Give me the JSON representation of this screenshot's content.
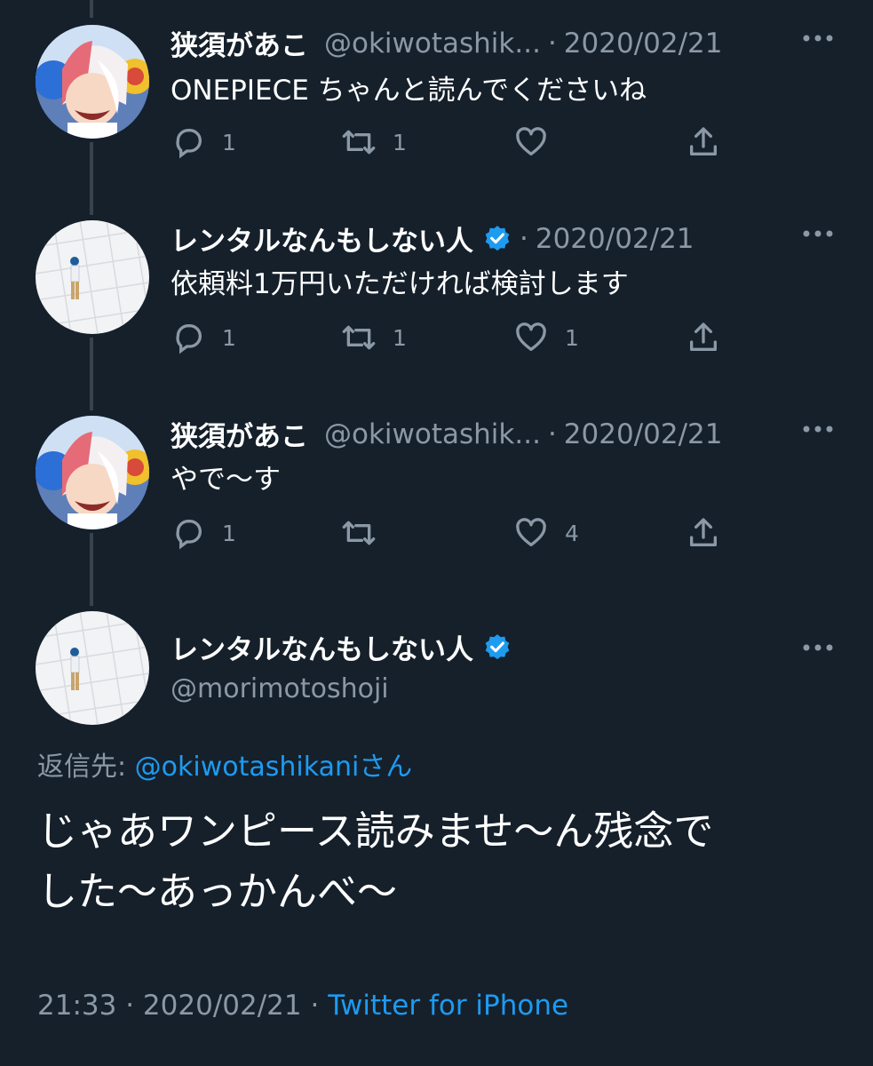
{
  "tweets": [
    {
      "name": "狭須があこ",
      "handle": "@okiwotashik...",
      "separator": "·",
      "date": "2020/02/21",
      "text": "ONEPIECE ちゃんと読んでくださいね",
      "reply_count": "1",
      "retweet_count": "1",
      "like_count": "",
      "avatar": "anime-character-avatar",
      "verified": false
    },
    {
      "name": "レンタルなんもしない人",
      "handle": "",
      "separator": "·",
      "date": "2020/02/21",
      "text": "依頼料1万円いただければ検討します",
      "reply_count": "1",
      "retweet_count": "1",
      "like_count": "1",
      "avatar": "person-on-tiles-avatar",
      "verified": true
    },
    {
      "name": "狭須があこ",
      "handle": "@okiwotashik...",
      "separator": "·",
      "date": "2020/02/21",
      "text": "やで〜す",
      "reply_count": "1",
      "retweet_count": "",
      "like_count": "4",
      "avatar": "anime-character-avatar",
      "verified": false
    }
  ],
  "main_tweet": {
    "name": "レンタルなんもしない人",
    "handle": "@morimotoshoji",
    "reply_label": "返信先:",
    "reply_mention": "@okiwotashikani",
    "reply_suffix": "さん",
    "text_line1": "じゃあワンピース読みませ〜ん残念で",
    "text_line2": "した〜あっかんべ〜",
    "time": "21:33",
    "date": "2020/02/21",
    "separator": "·",
    "client": "Twitter for iPhone"
  },
  "icons": [
    "reply-icon",
    "retweet-icon",
    "like-icon",
    "share-icon",
    "more-icon",
    "verified-badge-icon"
  ],
  "colors": {
    "background": "#15202b",
    "text": "#ffffff",
    "secondary_text": "#8b98a5",
    "accent": "#1d9bf0",
    "thread_line": "#38444d"
  }
}
